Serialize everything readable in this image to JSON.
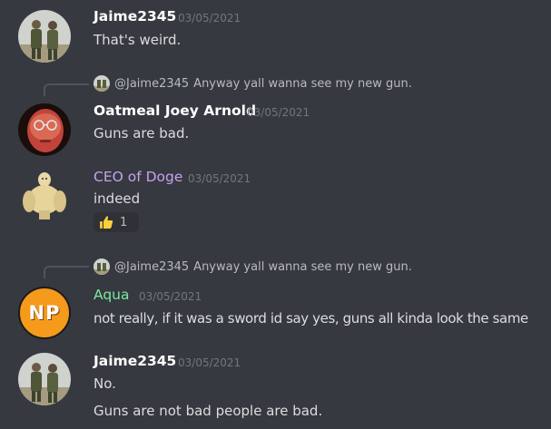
{
  "messages": [
    {
      "author": "Jaime2345",
      "timestamp": "03/05/2021",
      "lines": [
        "That's weird."
      ],
      "avatar_icon": "soldiers-avatar",
      "name_color": "#ffffff"
    },
    {
      "reply": {
        "user": "@Jaime2345",
        "text": "Anyway yall wanna see my new gun."
      },
      "author": "Oatmeal Joey Arnold",
      "timestamp": "03/05/2021",
      "lines": [
        "Guns are bad."
      ],
      "avatar_icon": "glasses-face-avatar",
      "name_color": "#ffffff"
    },
    {
      "author": "CEO of Doge",
      "timestamp": "03/05/2021",
      "lines": [
        "indeed"
      ],
      "avatar_icon": "buff-doge-avatar",
      "name_color": "#c9a0f0",
      "reaction": {
        "emoji_icon": "thumbs-up-icon",
        "count": "1"
      }
    },
    {
      "reply": {
        "user": "@Jaime2345",
        "text": "Anyway yall wanna see my new gun."
      },
      "author": "Aqua",
      "timestamp": "03/05/2021",
      "lines": [
        "not really, if it was a sword id say yes, guns all kinda look the same"
      ],
      "avatar_icon": "np-avatar",
      "avatar_text": "NP",
      "name_color": "#7ee8a0"
    },
    {
      "author": "Jaime2345",
      "timestamp": "03/05/2021",
      "lines": [
        "No.",
        "Guns are not bad people are bad."
      ],
      "avatar_icon": "soldiers-avatar",
      "name_color": "#ffffff"
    }
  ]
}
